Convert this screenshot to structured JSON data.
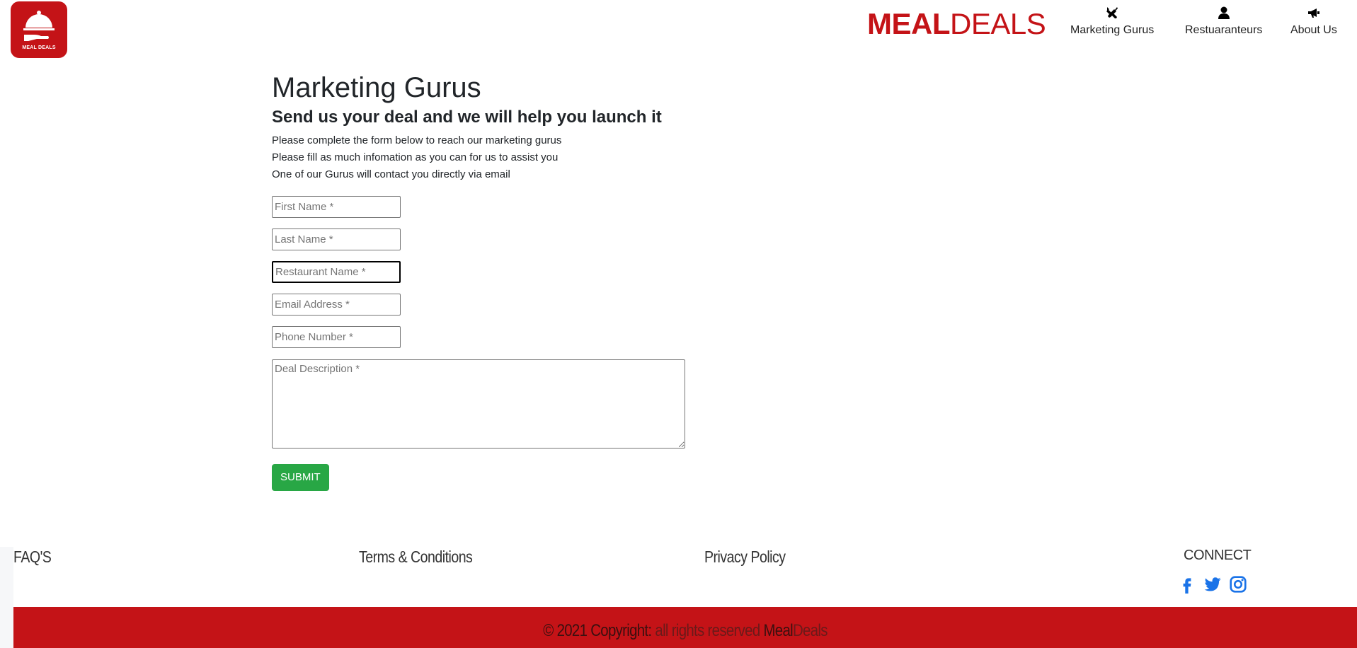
{
  "header": {
    "logo_caption": "MEAL DEALS",
    "brand_bold": "MEAL",
    "brand_light": "DEALS",
    "nav": [
      {
        "label": "Marketing Gurus",
        "icon": "tools-icon"
      },
      {
        "label": "Restuaranteurs",
        "icon": "user-icon"
      },
      {
        "label": "About Us",
        "icon": "megaphone-icon"
      }
    ]
  },
  "main": {
    "title": "Marketing Gurus",
    "subtitle": "Send us your deal and we will help you launch it",
    "intro": [
      "Please complete the form below to reach our marketing gurus",
      "Please fill as much infomation as you can for us to assist you",
      "One of our Gurus will contact you directly via email"
    ],
    "form": {
      "first_name": {
        "placeholder": "First Name *",
        "value": ""
      },
      "last_name": {
        "placeholder": "Last Name *",
        "value": ""
      },
      "restaurant_name": {
        "placeholder": "Restaurant Name *",
        "value": ""
      },
      "email": {
        "placeholder": "Email Address *",
        "value": ""
      },
      "phone": {
        "placeholder": "Phone Number *",
        "value": ""
      },
      "description": {
        "placeholder": "Deal Description *",
        "value": ""
      },
      "submit_label": "SUBMIT"
    }
  },
  "footer": {
    "links": [
      "FAQ'S",
      "Terms & Conditions",
      "Privacy Policy"
    ],
    "connect_label": "CONNECT",
    "social": [
      "facebook-icon",
      "twitter-icon",
      "instagram-icon"
    ],
    "copyright_prefix": "© 2021 Copyright:",
    "copyright_middle": "all rights reserved",
    "copyright_brand_1": "Meal",
    "copyright_brand_2": "Deals"
  },
  "colors": {
    "brand_red": "#c41317",
    "submit_green": "#28a745",
    "social_blue": "#1a73e8"
  }
}
